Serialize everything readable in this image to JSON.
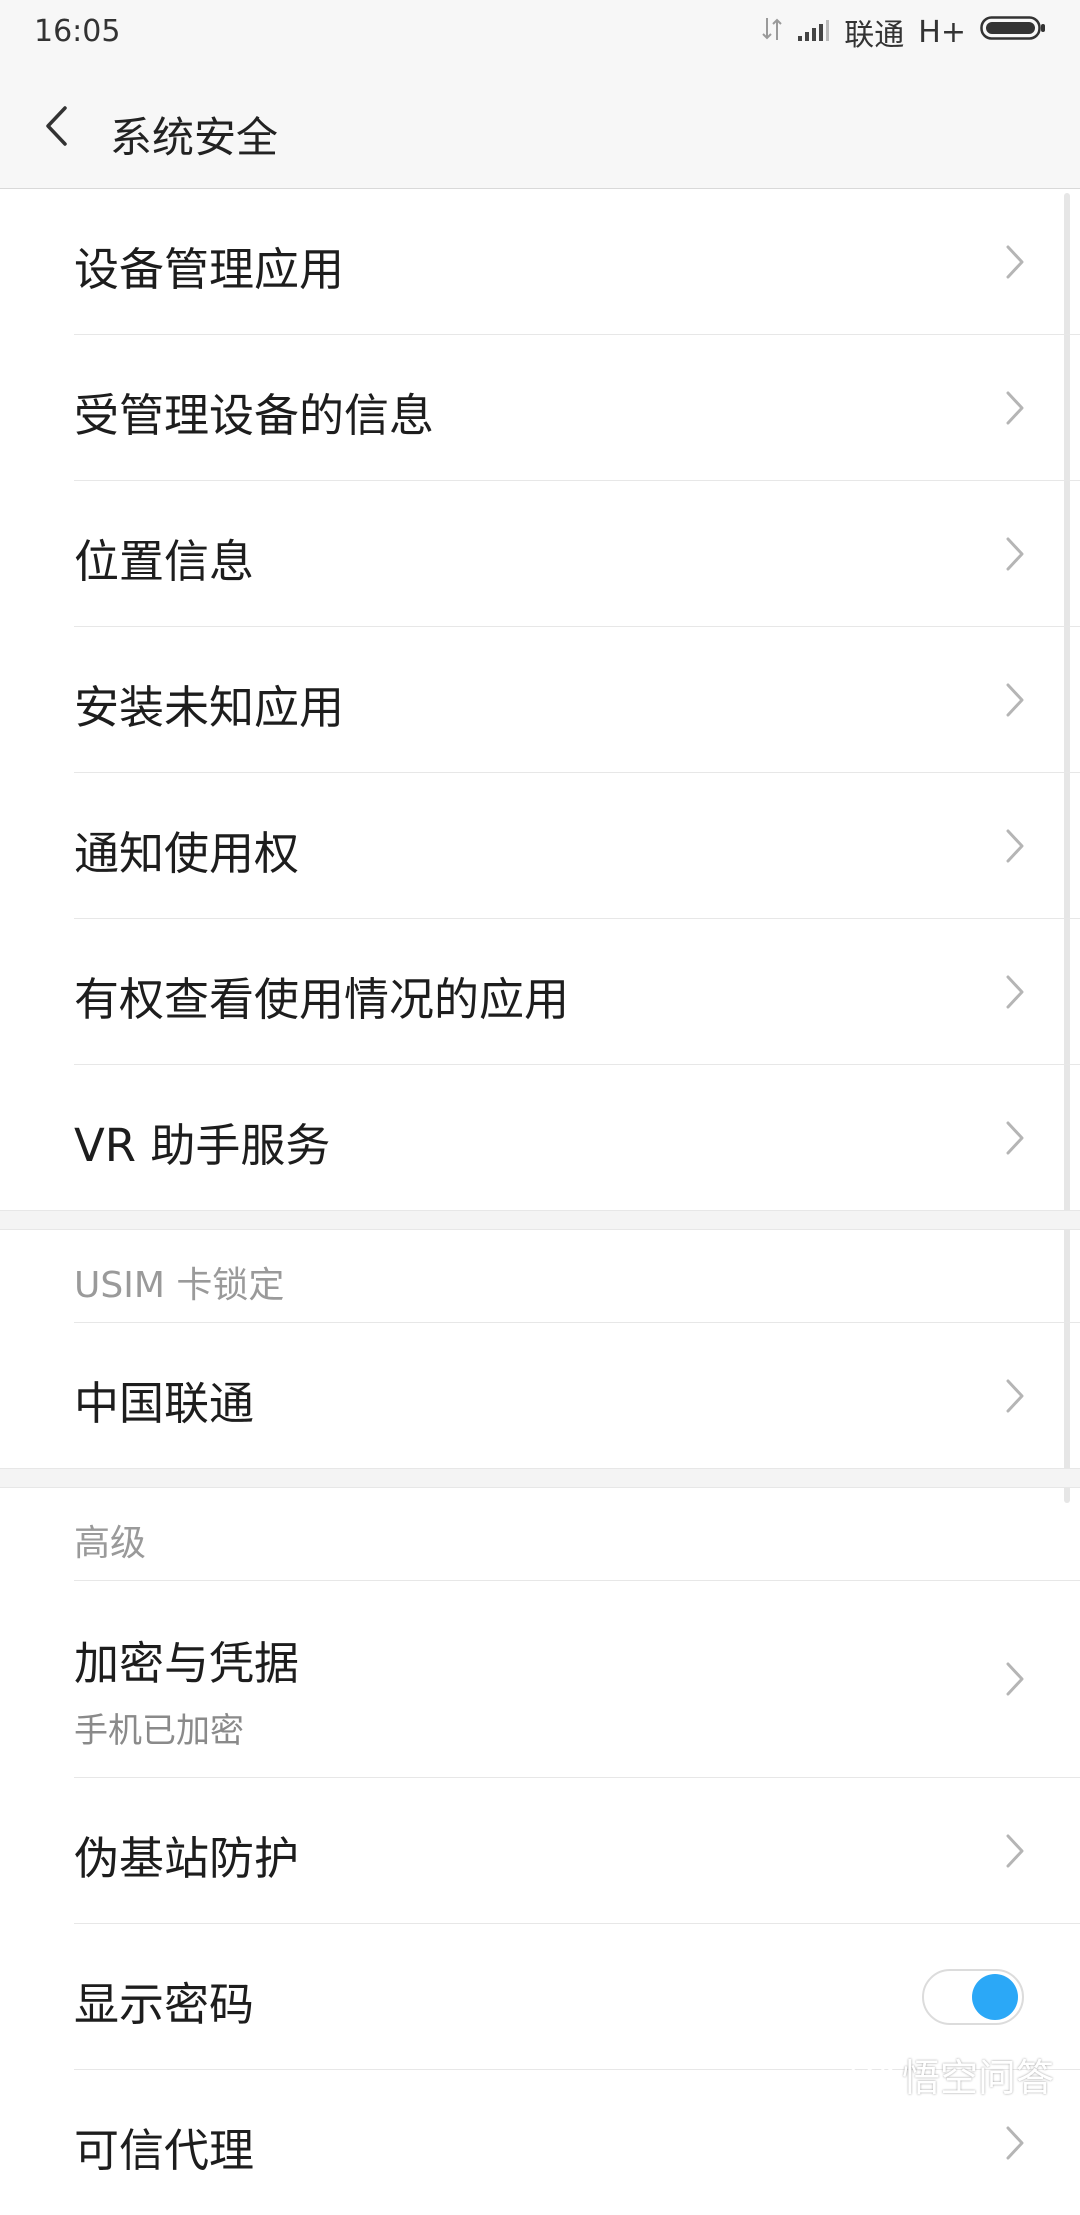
{
  "status": {
    "time": "16:05",
    "carrier": "联通",
    "network": "H+"
  },
  "header": {
    "title": "系统安全"
  },
  "items": [
    {
      "label": "设备管理应用"
    },
    {
      "label": "受管理设备的信息"
    },
    {
      "label": "位置信息"
    },
    {
      "label": "安装未知应用"
    },
    {
      "label": "通知使用权"
    },
    {
      "label": "有权查看使用情况的应用"
    },
    {
      "label": "VR 助手服务"
    }
  ],
  "sections": {
    "usim": {
      "title": "USIM 卡锁定",
      "items": [
        {
          "label": "中国联通"
        }
      ]
    },
    "advanced": {
      "title": "高级",
      "items": [
        {
          "label": "加密与凭据",
          "sub": "手机已加密"
        },
        {
          "label": "伪基站防护"
        },
        {
          "label": "显示密码",
          "toggle_on": true
        },
        {
          "label": "可信代理"
        }
      ]
    }
  },
  "watermark": "悟空问答",
  "colors": {
    "accent": "#2ba8f7"
  }
}
